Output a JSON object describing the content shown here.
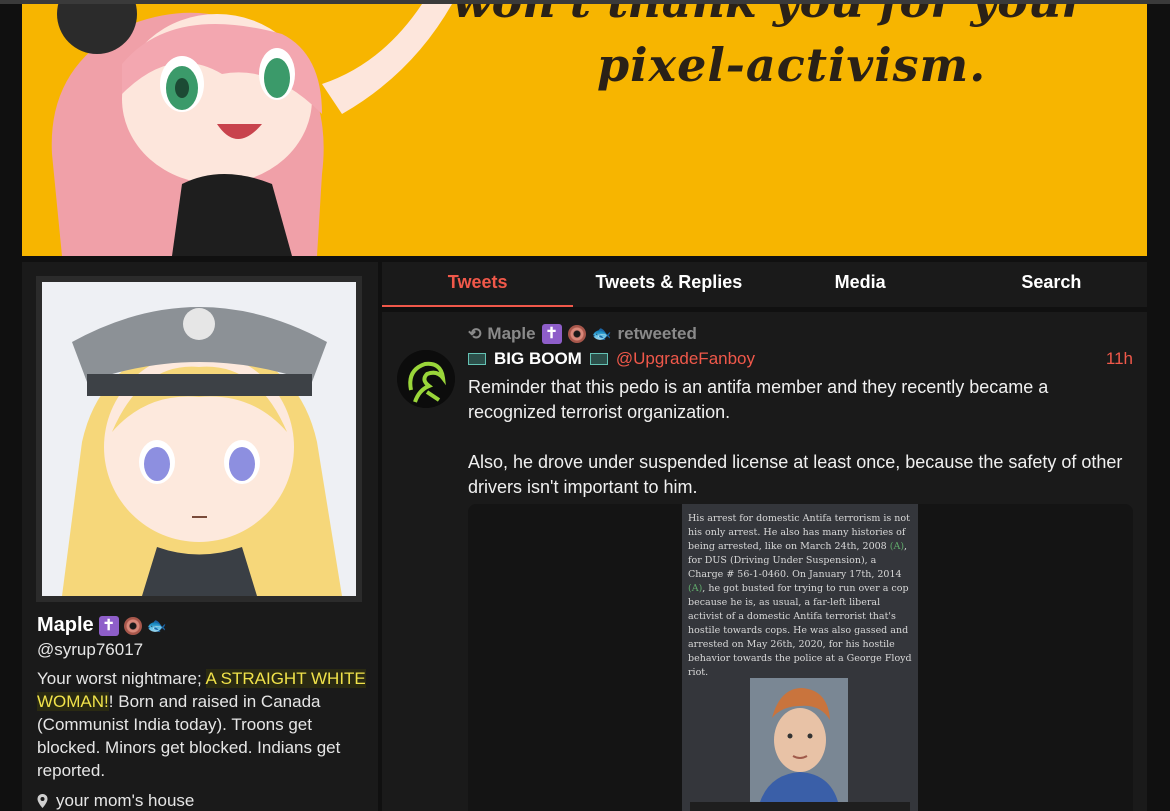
{
  "banner": {
    "line_top": "won't thank you for your",
    "line_main": "pixel-activism."
  },
  "profile": {
    "name": "Maple",
    "handle": "@syrup76017",
    "bio_before": "Your worst nightmare; ",
    "bio_highlight": "A STRAIGHT WHITE WOMAN!",
    "bio_after": "! Born and raised in Canada (Communist India today). Troons get blocked. Minors get blocked. Indians get reported.",
    "location": "your mom's house",
    "name_emoji": [
      "cross-emoji",
      "donut-emoji",
      "fish-emoji"
    ]
  },
  "tabs": [
    {
      "label": "Tweets",
      "active": true
    },
    {
      "label": "Tweets & Replies",
      "active": false
    },
    {
      "label": "Media",
      "active": false
    },
    {
      "label": "Search",
      "active": false
    }
  ],
  "tweet": {
    "retweeted_by": "Maple",
    "retweeted_label": "retweeted",
    "author_name": "BIG BOOM",
    "author_handle": "@UpgradeFanboy",
    "time": "11h",
    "paragraph_1": "Reminder that this pedo is an antifa member and they recently became a recognized terrorist organization.",
    "paragraph_2": "Also, he drove under suspended license at least once, because the safety of other drivers isn't important to him.",
    "media_text_1": "His arrest for domestic Antifa terrorism is not his only arrest. He also has many histories of being arrested, like on March 24th, 2008 ",
    "media_link_1": "(A)",
    "media_text_2": ", for DUS (Driving Under Suspension), a Charge # 56-1-0460. On January 17th, 2014 ",
    "media_link_2": "(A)",
    "media_text_3": ", he got busted for trying to run over a cop because he is, as usual, a far-left liberal activist of a domestic Antifa terrorist that's hostile towards cops. He was also gassed and arrested on May 26th, 2020, for his hostile behavior towards the police at a George Floyd riot."
  },
  "colors": {
    "accent": "#f0584a",
    "banner_bg": "#f7b500",
    "panel_bg": "#1a1a1a",
    "page_bg": "#101010",
    "highlight": "#f0e24a"
  }
}
